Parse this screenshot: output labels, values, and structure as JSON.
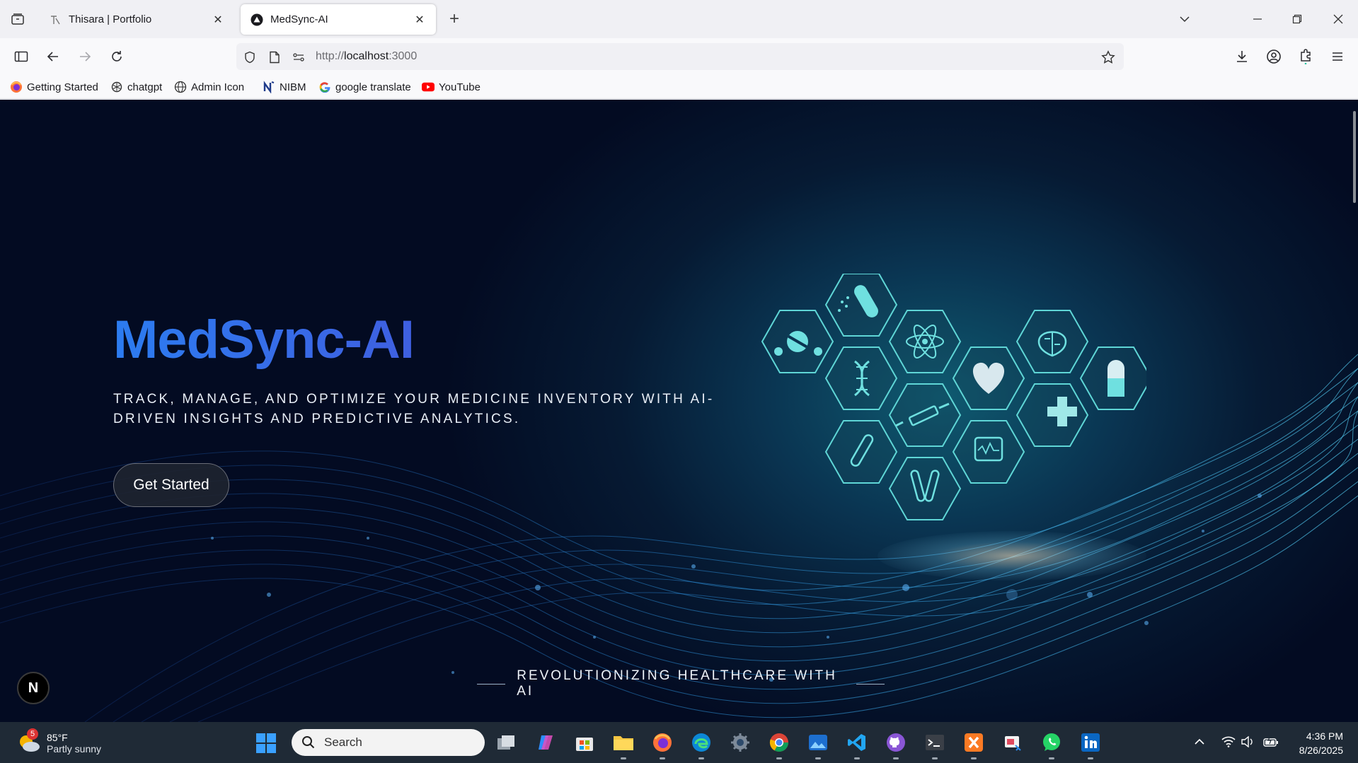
{
  "browser": {
    "tabs": [
      {
        "title": "Thisara | Portfolio",
        "active": false
      },
      {
        "title": "MedSync-AI",
        "active": true
      }
    ],
    "url_scheme": "http://",
    "url_host": "localhost",
    "url_port": ":3000",
    "bookmarks": [
      {
        "label": "Getting Started",
        "icon": "firefox-icon"
      },
      {
        "label": "chatgpt",
        "icon": "chatgpt-icon"
      },
      {
        "label": "Admin Icon",
        "icon": "globe-icon"
      },
      {
        "label": "NIBM",
        "icon": "nibm-icon"
      },
      {
        "label": "google translate",
        "icon": "google-icon"
      },
      {
        "label": "YouTube",
        "icon": "youtube-icon"
      }
    ]
  },
  "hero": {
    "title": "MedSync-AI",
    "subtitle": "TRACK, MANAGE, AND OPTIMIZE YOUR MEDICINE INVENTORY WITH AI-DRIVEN INSIGHTS AND PREDICTIVE ANALYTICS.",
    "cta_label": "Get Started",
    "tagline": "REVOLUTIONIZING HEALTHCARE WITH AI",
    "nextjs_badge": "N"
  },
  "taskbar": {
    "weather_temp": "85°F",
    "weather_desc": "Partly sunny",
    "weather_badge": "5",
    "search_placeholder": "Search",
    "time": "4:36 PM",
    "date": "8/26/2025"
  },
  "colors": {
    "title_gradient_start": "#2c7cf0",
    "title_gradient_end": "#3f5fe0",
    "page_bg_dark": "#030b22",
    "page_bg_teal": "#0f5a70",
    "hex_stroke": "#5fd6d6",
    "taskbar_bg": "#1f2a36"
  }
}
